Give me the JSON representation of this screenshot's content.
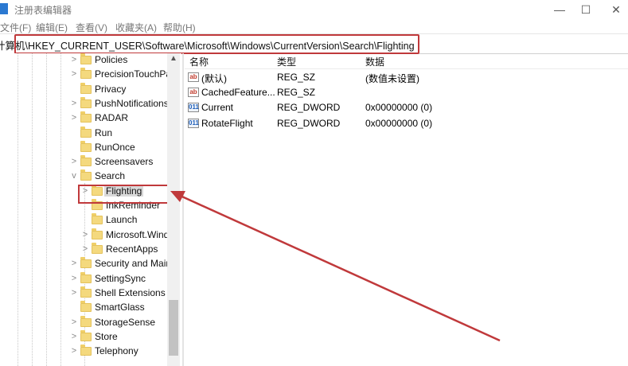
{
  "window": {
    "title": "注册表编辑器",
    "controls": {
      "minimize": "—",
      "maximize": "☐",
      "close": "✕"
    }
  },
  "menu": [
    {
      "label": "文件(F)"
    },
    {
      "label": "编辑(E)"
    },
    {
      "label": "查看(V)"
    },
    {
      "label": "收藏夹(A)"
    },
    {
      "label": "帮助(H)"
    }
  ],
  "address": {
    "path": "计算机\\HKEY_CURRENT_USER\\Software\\Microsoft\\Windows\\CurrentVersion\\Search\\Flighting"
  },
  "tree": {
    "items": [
      {
        "label": "Policies",
        "expander": ">"
      },
      {
        "label": "PrecisionTouchPa",
        "expander": ">"
      },
      {
        "label": "Privacy",
        "expander": ""
      },
      {
        "label": "PushNotifications",
        "expander": ">"
      },
      {
        "label": "RADAR",
        "expander": ">"
      },
      {
        "label": "Run",
        "expander": ""
      },
      {
        "label": "RunOnce",
        "expander": ""
      },
      {
        "label": "Screensavers",
        "expander": ">"
      },
      {
        "label": "Search",
        "expander": "v"
      },
      {
        "label": "Flighting",
        "expander": ">"
      },
      {
        "label": "InkReminder",
        "expander": ""
      },
      {
        "label": "Launch",
        "expander": ""
      },
      {
        "label": "Microsoft.Wind",
        "expander": ">"
      },
      {
        "label": "RecentApps",
        "expander": ">"
      },
      {
        "label": "Security and Main",
        "expander": ">"
      },
      {
        "label": "SettingSync",
        "expander": ">"
      },
      {
        "label": "Shell Extensions",
        "expander": ">"
      },
      {
        "label": "SmartGlass",
        "expander": ""
      },
      {
        "label": "StorageSense",
        "expander": ">"
      },
      {
        "label": "Store",
        "expander": ">"
      },
      {
        "label": "Telephony",
        "expander": ">"
      }
    ],
    "scroll_up": "▲"
  },
  "values": {
    "headers": {
      "name": "名称",
      "type": "类型",
      "data": "数据"
    },
    "rows": [
      {
        "icon": "string-value-icon",
        "glyph": "ab",
        "name": "(默认)",
        "type": "REG_SZ",
        "data": "(数值未设置)"
      },
      {
        "icon": "string-value-icon",
        "glyph": "ab",
        "name": "CachedFeature...",
        "type": "REG_SZ",
        "data": ""
      },
      {
        "icon": "dword-value-icon",
        "glyph": "011",
        "name": "Current",
        "type": "REG_DWORD",
        "data": "0x00000000 (0)"
      },
      {
        "icon": "dword-value-icon",
        "glyph": "011",
        "name": "RotateFlight",
        "type": "REG_DWORD",
        "data": "0x00000000 (0)"
      }
    ]
  },
  "annotation_color": "#c0393b"
}
